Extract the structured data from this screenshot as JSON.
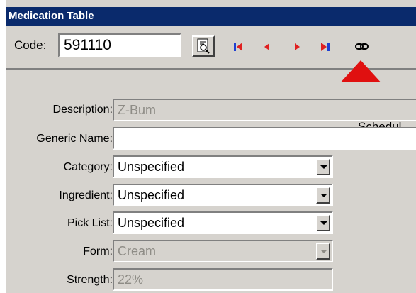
{
  "window": {
    "title": "Medication Table"
  },
  "toolbar": {
    "code_label": "Code:",
    "code_value": "591110",
    "lookup_icon": "search-document-icon",
    "nav_icons": [
      "first-record-icon",
      "previous-record-icon",
      "next-record-icon",
      "last-record-icon",
      "link-icon"
    ]
  },
  "form": {
    "description": {
      "label": "Description:",
      "value": "Z-Bum"
    },
    "generic_name": {
      "label": "Generic Name:",
      "value": ""
    },
    "category": {
      "label": "Category:",
      "value": "Unspecified"
    },
    "ingredient": {
      "label": "Ingredient:",
      "value": "Unspecified"
    },
    "pick_list": {
      "label": "Pick List:",
      "value": "Unspecified"
    },
    "form": {
      "label": "Form:",
      "value": "Cream"
    },
    "strength": {
      "label": "Strength:",
      "value": "22%"
    },
    "schedule_label": "Schedul"
  },
  "colors": {
    "accent_red": "#e01010",
    "nav_red": "#e02020",
    "nav_blue": "#1f3fd0",
    "titlebar": "#0a2a6c"
  }
}
